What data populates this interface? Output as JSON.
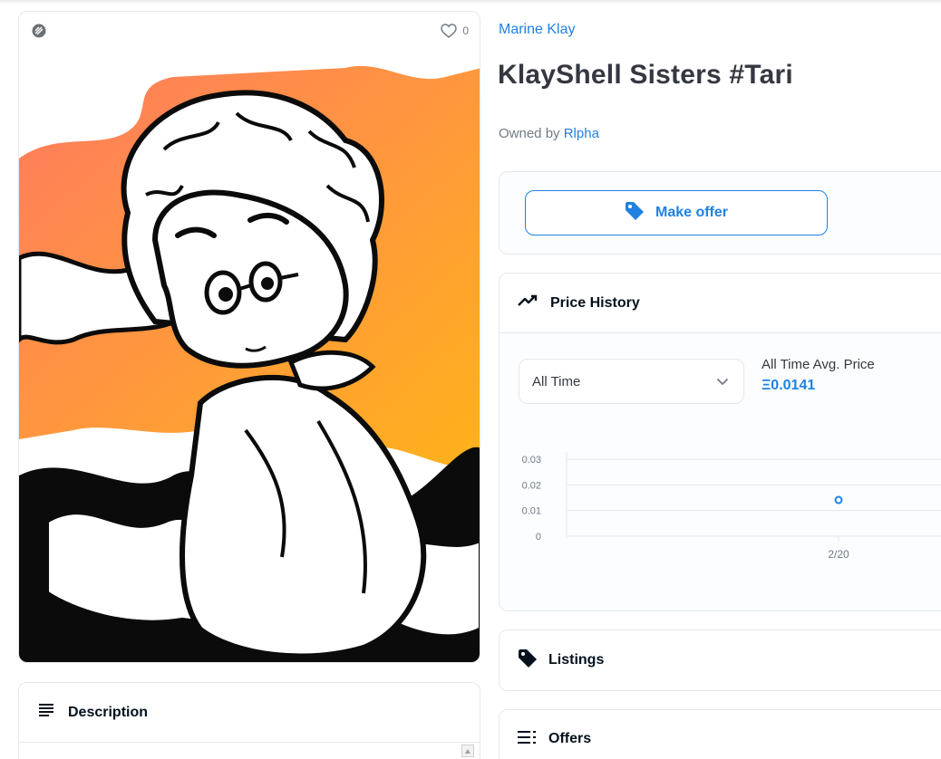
{
  "item": {
    "collection_name": "Marine Klay",
    "title": "KlayShell Sisters #Tari",
    "owned_by_label": "Owned by",
    "owner_name": "Rlpha",
    "favorites_count": "0"
  },
  "actions": {
    "make_offer_label": "Make offer"
  },
  "panels": {
    "description_label": "Description",
    "price_history_label": "Price History",
    "listings_label": "Listings",
    "offers_label": "Offers"
  },
  "price_history": {
    "range_selected": "All Time",
    "avg_label": "All Time Avg. Price",
    "avg_value": "Ξ0.0141"
  },
  "chart_data": {
    "type": "scatter",
    "title": "",
    "xlabel": "",
    "ylabel": "",
    "x_ticks": [
      "2/20"
    ],
    "y_ticks": [
      "0",
      "0.01",
      "0.02",
      "0.03"
    ],
    "ylim": [
      0,
      0.03
    ],
    "grid": true,
    "points": [
      {
        "x": "2/20",
        "y": 0.0141
      }
    ]
  },
  "colors": {
    "accent": "#2081e2",
    "border": "#e5e8eb",
    "text": "#353840"
  }
}
